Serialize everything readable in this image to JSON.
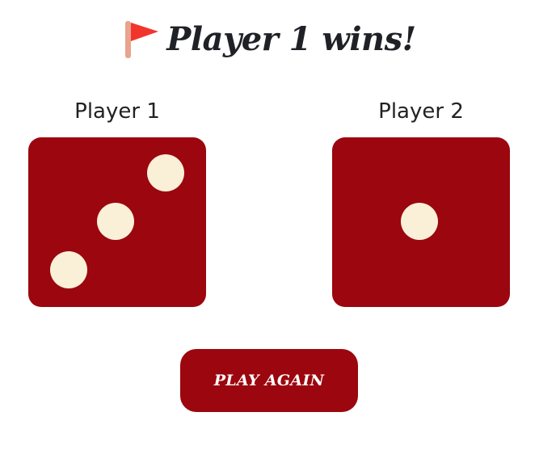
{
  "header": {
    "icon": "red-flag-icon",
    "title": "Player 1 wins!"
  },
  "players": [
    {
      "label": "Player 1",
      "die_value": 3
    },
    {
      "label": "Player 2",
      "die_value": 1
    }
  ],
  "controls": {
    "play_again_label": "PLAY AGAIN"
  },
  "colors": {
    "die_face": "#9c060e",
    "pip": "#faf0d7",
    "button": "#9c060e",
    "flag": "#f1352d",
    "flag_pole": "#e8a48e",
    "title_text": "#1f2126"
  }
}
